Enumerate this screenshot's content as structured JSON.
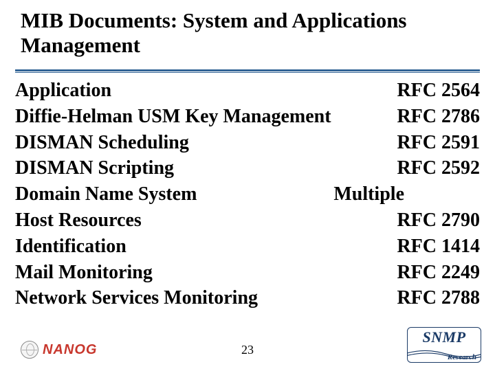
{
  "title": "MIB Documents: System and Applications Management",
  "rows": [
    {
      "name": "Application",
      "rfc": "RFC 2564",
      "multiple": false
    },
    {
      "name": "Diffie-Helman USM Key Management",
      "rfc": "RFC 2786",
      "multiple": false
    },
    {
      "name": "DISMAN Scheduling",
      "rfc": "RFC 2591",
      "multiple": false
    },
    {
      "name": "DISMAN Scripting",
      "rfc": "RFC 2592",
      "multiple": false
    },
    {
      "name": "Domain Name System",
      "rfc": "Multiple",
      "multiple": true
    },
    {
      "name": "Host Resources",
      "rfc": "RFC 2790",
      "multiple": false
    },
    {
      "name": "Identification",
      "rfc": "RFC 1414",
      "multiple": false
    },
    {
      "name": "Mail Monitoring",
      "rfc": "RFC 2249",
      "multiple": false
    },
    {
      "name": "Network Services Monitoring",
      "rfc": "RFC 2788",
      "multiple": false
    }
  ],
  "page_number": "23",
  "logo_left": {
    "text": "NANOG"
  },
  "logo_right": {
    "main": "SNMP",
    "sub": "Research"
  }
}
